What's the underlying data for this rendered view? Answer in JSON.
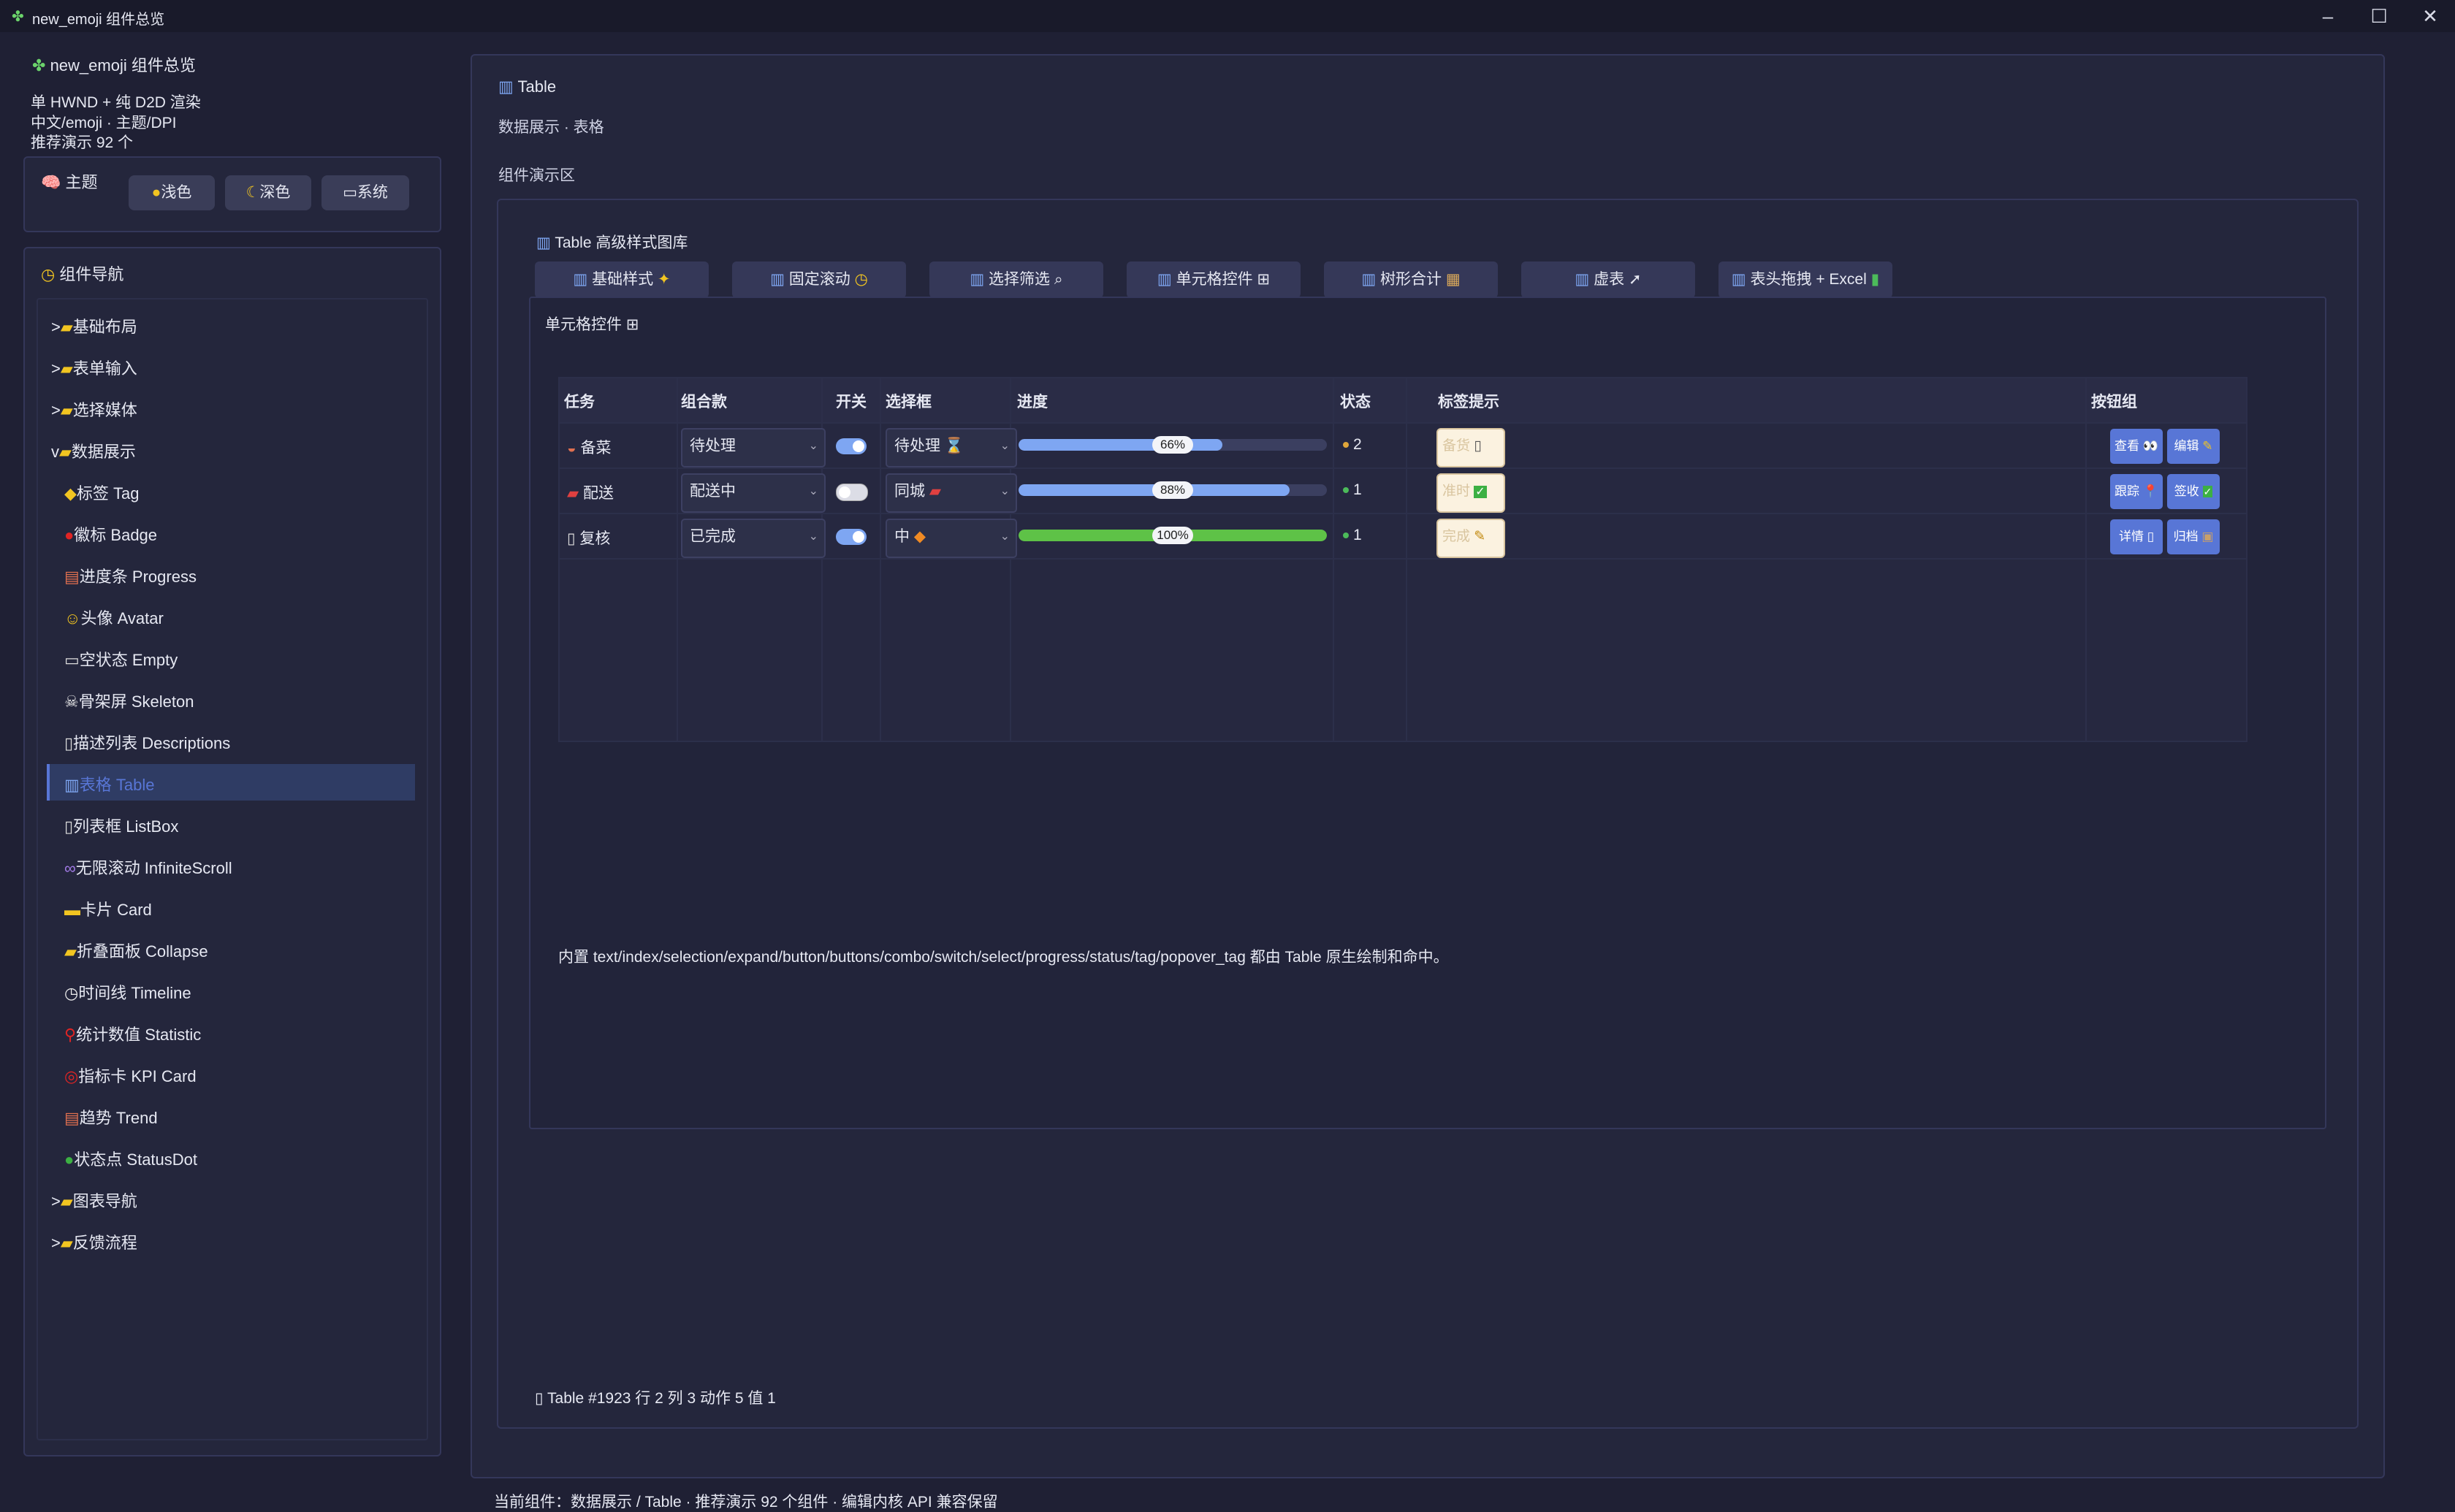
{
  "window": {
    "title": "new_emoji 组件总览",
    "icon": "✤"
  },
  "sidebar": {
    "title": "new_emoji 组件总览",
    "info": [
      "单 HWND + 纯 D2D 渲染",
      "中文/emoji · 主题/DPI",
      "推荐演示 92 个"
    ],
    "theme_label": "主题",
    "theme_buttons": [
      "浅色",
      "深色",
      "系统"
    ],
    "nav_label": "组件导航",
    "nav_items": [
      {
        "label": "基础布局",
        "type": "folder",
        "prefix": ">"
      },
      {
        "label": "表单输入",
        "type": "folder",
        "prefix": ">"
      },
      {
        "label": "选择媒体",
        "type": "folder",
        "prefix": ">"
      },
      {
        "label": "数据展示",
        "type": "folder",
        "prefix": "v"
      },
      {
        "label": "标签 Tag",
        "type": "item"
      },
      {
        "label": "徽标 Badge",
        "type": "item"
      },
      {
        "label": "进度条 Progress",
        "type": "item"
      },
      {
        "label": "头像 Avatar",
        "type": "item"
      },
      {
        "label": "空状态 Empty",
        "type": "item"
      },
      {
        "label": "骨架屏 Skeleton",
        "type": "item"
      },
      {
        "label": "描述列表 Descriptions",
        "type": "item"
      },
      {
        "label": "表格 Table",
        "type": "item",
        "active": true
      },
      {
        "label": "列表框 ListBox",
        "type": "item"
      },
      {
        "label": "无限滚动 InfiniteScroll",
        "type": "item"
      },
      {
        "label": "卡片 Card",
        "type": "item"
      },
      {
        "label": "折叠面板 Collapse",
        "type": "item"
      },
      {
        "label": "时间线 Timeline",
        "type": "item"
      },
      {
        "label": "统计数值 Statistic",
        "type": "item"
      },
      {
        "label": "指标卡 KPI Card",
        "type": "item"
      },
      {
        "label": "趋势 Trend",
        "type": "item"
      },
      {
        "label": "状态点 StatusDot",
        "type": "item"
      },
      {
        "label": "图表导航",
        "type": "folder",
        "prefix": ">"
      },
      {
        "label": "反馈流程",
        "type": "folder",
        "prefix": ">"
      }
    ]
  },
  "main": {
    "title": "Table",
    "subtitle": "数据展示 · 表格",
    "section_label": "组件演示区",
    "gallery_title": "Table 高级样式图库",
    "tabs": [
      "基础样式",
      "固定滚动",
      "选择筛选",
      "单元格控件",
      "树形合计",
      "虚表",
      "表头拖拽 + Excel"
    ],
    "active_tab_label": "单元格控件",
    "table": {
      "headers": [
        "任务",
        "组合款",
        "开关",
        "选择框",
        "进度",
        "状态",
        "标签提示",
        "按钮组"
      ],
      "rows": [
        {
          "task": "备菜",
          "combo": "待处理",
          "switch_on": true,
          "select": "待处理",
          "progress": 66,
          "progress_label": "66%",
          "status": "2",
          "status_color": "#e0a63a",
          "tag": "备货",
          "buttons": [
            "查看",
            "编辑"
          ]
        },
        {
          "task": "配送",
          "combo": "配送中",
          "switch_on": false,
          "select": "同城",
          "progress": 88,
          "progress_label": "88%",
          "status": "1",
          "status_color": "#4cbb5a",
          "tag": "准时",
          "buttons": [
            "跟踪",
            "签收"
          ]
        },
        {
          "task": "复核",
          "combo": "已完成",
          "switch_on": true,
          "select": "中",
          "progress": 100,
          "progress_label": "100%",
          "status": "1",
          "status_color": "#4cbb5a",
          "tag": "完成",
          "buttons": [
            "详情",
            "归档"
          ]
        }
      ]
    },
    "description": "内置 text/index/selection/expand/button/buttons/combo/switch/select/progress/status/tag/popover_tag 都由 Table 原生绘制和命中。",
    "footer_stat": "Table #1923 行 2 列 3 动作 5 值 1",
    "status_line": "当前组件：数据展示 / Table · 推荐演示 92 个组件 · 编辑内核 API 兼容保留"
  },
  "colors": {
    "accent": "#5876d6",
    "bar_blue": "#7ea6f2",
    "bar_green": "#5ec247",
    "bg": "#1f2034"
  }
}
